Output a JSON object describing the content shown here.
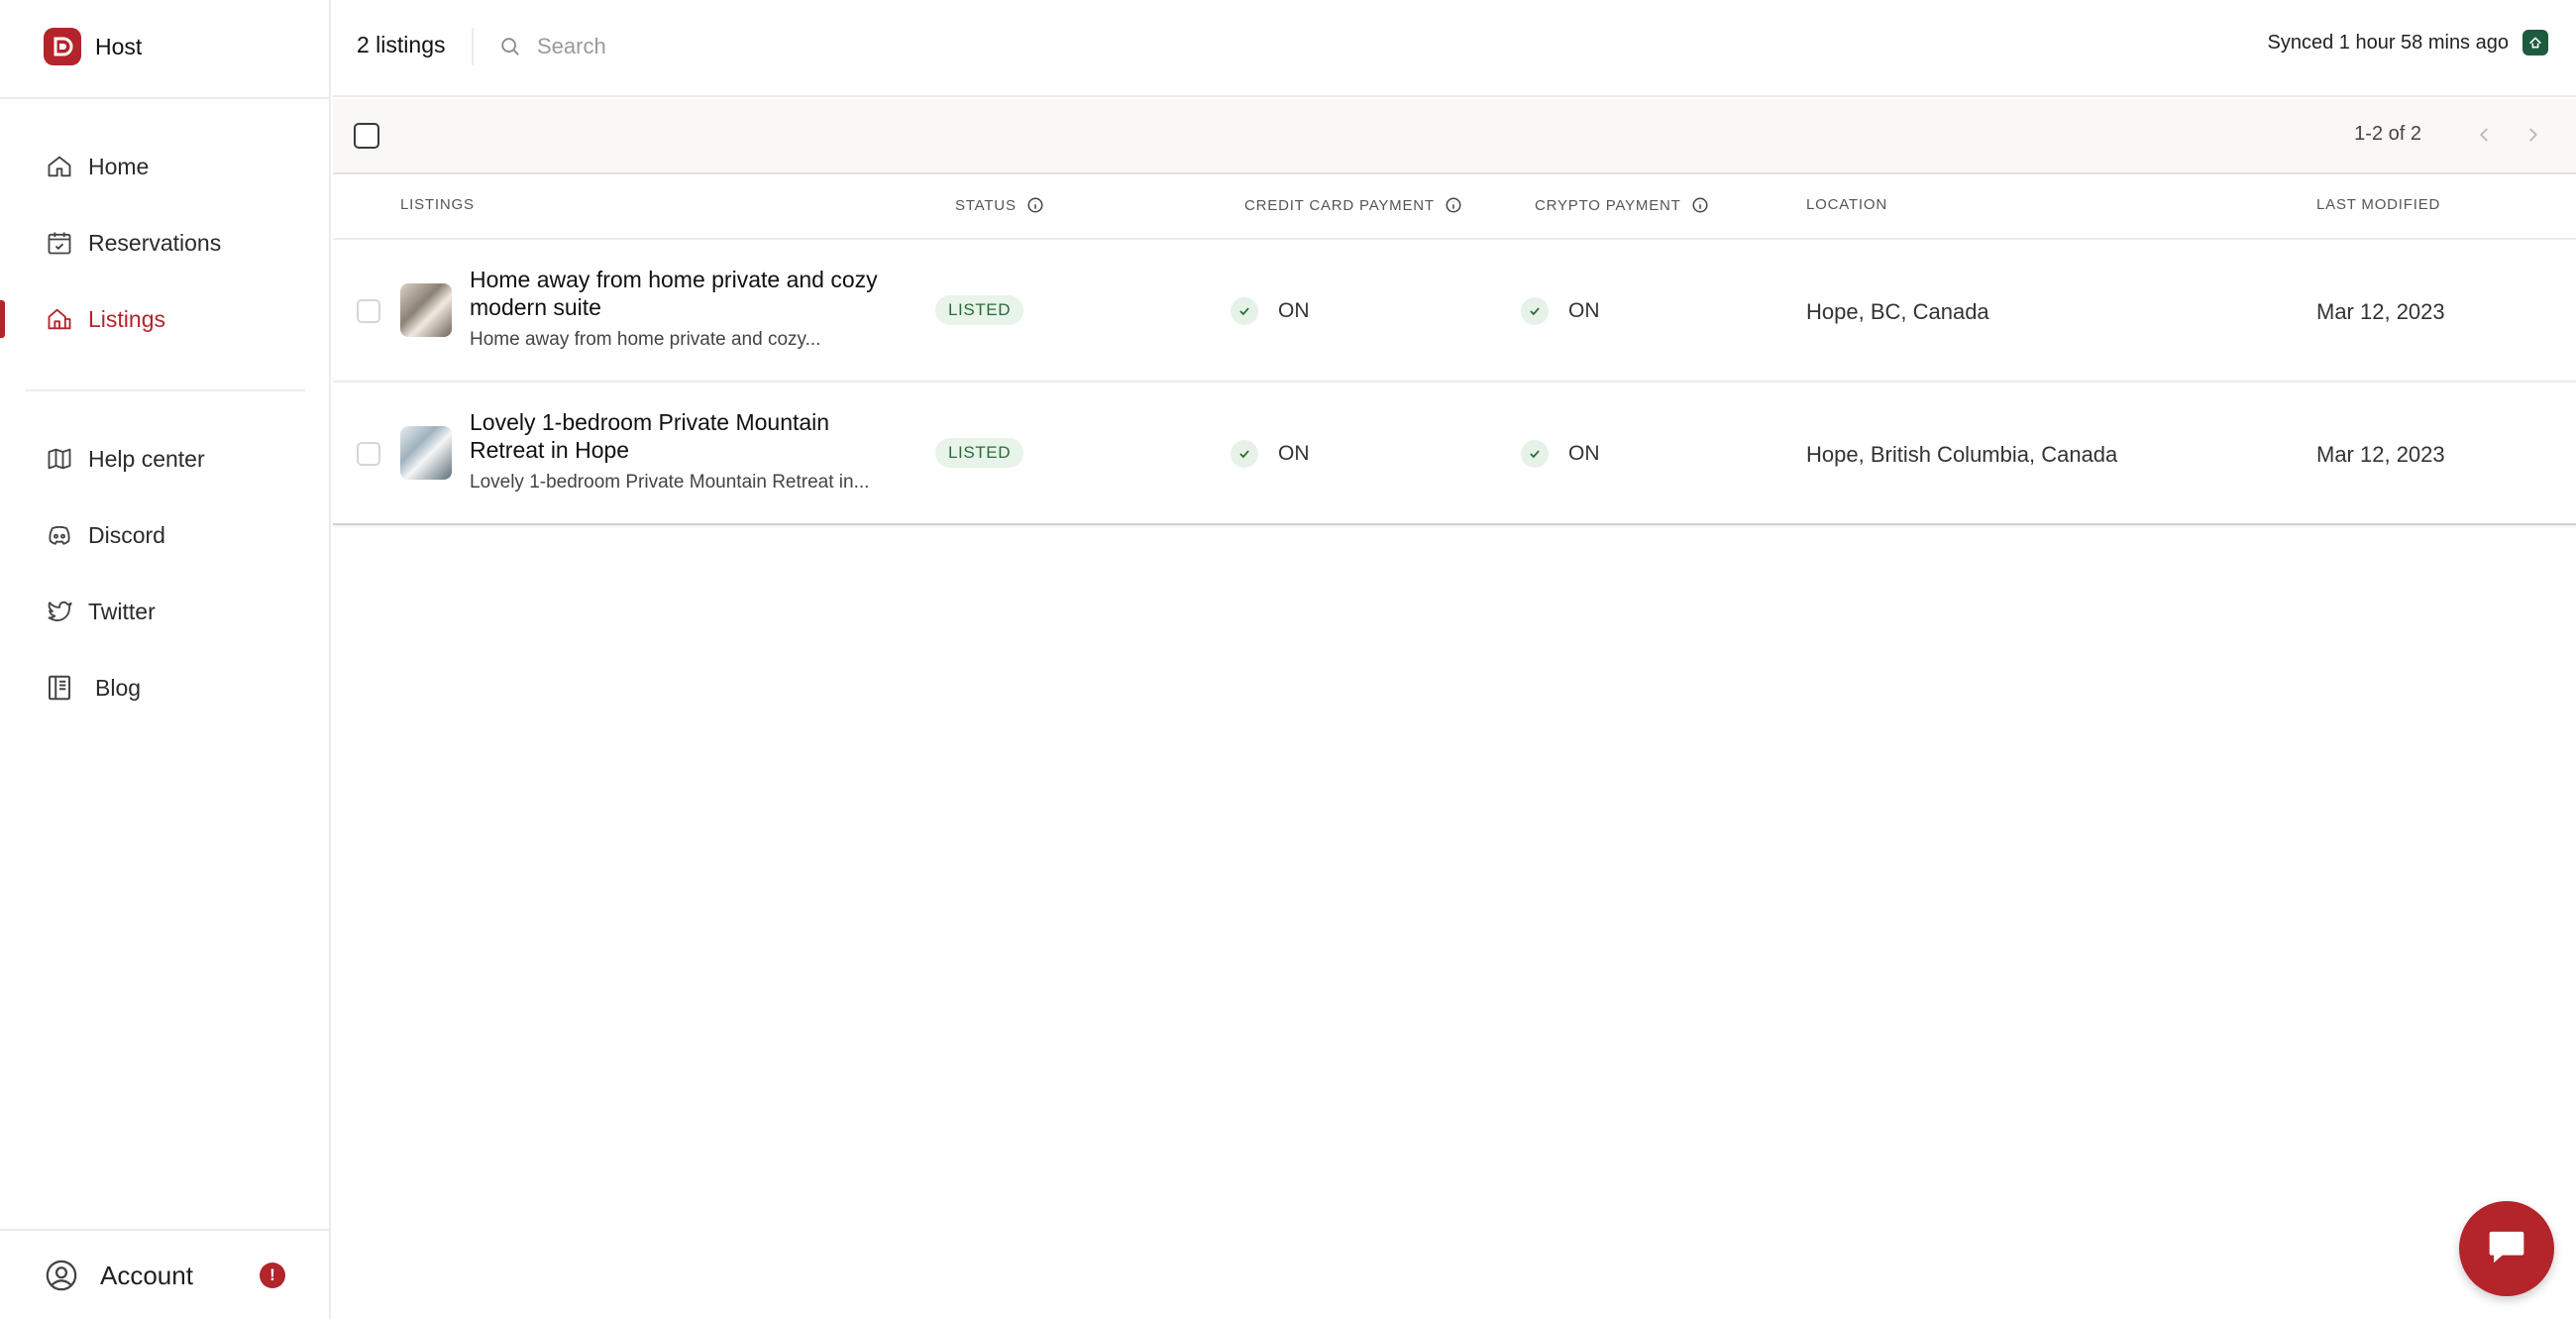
{
  "brand": {
    "name": "Host",
    "logo_letter": "D",
    "accent": "#b3242b"
  },
  "nav": {
    "items": [
      {
        "label": "Home",
        "icon": "home-icon"
      },
      {
        "label": "Reservations",
        "icon": "calendar-icon"
      },
      {
        "label": "Listings",
        "icon": "building-icon",
        "active": true
      }
    ],
    "secondary": [
      {
        "label": "Help center",
        "icon": "map-icon"
      },
      {
        "label": "Discord",
        "icon": "discord-icon"
      },
      {
        "label": "Twitter",
        "icon": "twitter-icon"
      },
      {
        "label": "Blog",
        "icon": "book-icon"
      }
    ],
    "account": {
      "label": "Account",
      "alert": "!"
    }
  },
  "topbar": {
    "listing_count": "2 listings",
    "search_placeholder": "Search",
    "sync_text": "Synced 1 hour 58 mins ago"
  },
  "toolbar": {
    "pagination": "1-2 of 2"
  },
  "table": {
    "headers": {
      "listings": "LISTINGS",
      "status": "STATUS",
      "credit_card": "CREDIT CARD PAYMENT",
      "crypto": "CRYPTO PAYMENT",
      "location": "LOCATION",
      "last_modified": "LAST MODIFIED"
    },
    "rows": [
      {
        "title": "Home away from home private and cozy modern suite",
        "subtitle": "Home away from home private and cozy...",
        "status": "LISTED",
        "credit_card": "ON",
        "crypto": "ON",
        "location": "Hope, BC, Canada",
        "last_modified": "Mar 12, 2023"
      },
      {
        "title": "Lovely 1-bedroom Private Mountain Retreat in Hope",
        "subtitle": "Lovely 1-bedroom Private Mountain Retreat in...",
        "status": "LISTED",
        "credit_card": "ON",
        "crypto": "ON",
        "location": "Hope, British Columbia, Canada",
        "last_modified": "Mar 12, 2023"
      }
    ]
  }
}
